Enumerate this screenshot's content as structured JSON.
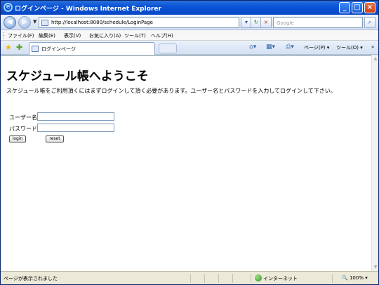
{
  "window": {
    "title": "ログインページ - Windows Internet Explorer"
  },
  "address_bar": {
    "url": "http://localhost:8080/schedule/LoginPage",
    "search_placeholder": "Google"
  },
  "menu": {
    "items": [
      "ファイル(F)",
      "編集(E)",
      "表示(V)",
      "お気に入り(A)",
      "ツール(T)",
      "ヘルプ(H)"
    ]
  },
  "tabs": {
    "active_label": "ログインページ"
  },
  "command_bar": {
    "page_label": "ページ(P)",
    "tools_label": "ツール(O)"
  },
  "page": {
    "heading": "スケジュール帳へようこそ",
    "intro": "スケジュール帳をご利用頂くにはまずログインして頂く必要があります。ユーザー名とパスワードを入力してログインして下さい。",
    "username_label": "ユーザー名",
    "password_label": "パスワード",
    "username_value": "",
    "password_value": "",
    "login_button": "login",
    "reset_button": "reset"
  },
  "status_bar": {
    "status": "ページが表示されました",
    "zone": "インターネット",
    "zoom": "100%"
  }
}
